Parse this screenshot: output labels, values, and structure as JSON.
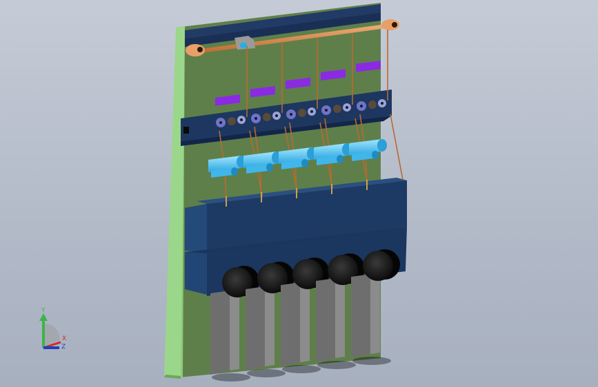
{
  "scene": {
    "background_color": "#b8bfcc",
    "units_count": 5
  },
  "triad": {
    "y_label": "Y",
    "x_label": "X",
    "z_label": "Z",
    "y_color": "#3cb44b",
    "x_color": "#d62728",
    "z_color": "#1f3fbf"
  }
}
